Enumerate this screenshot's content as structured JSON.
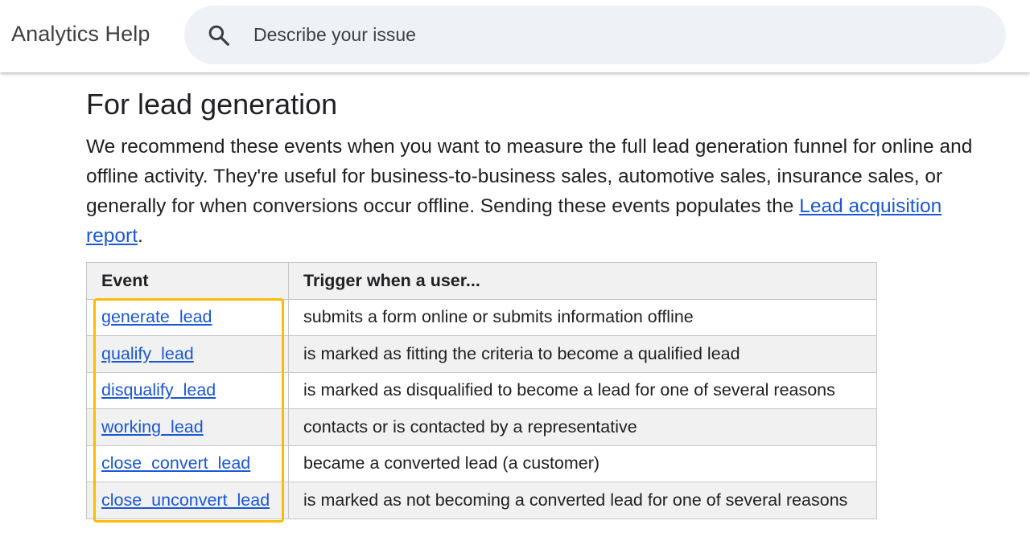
{
  "header": {
    "brand": "Analytics Help",
    "search": {
      "placeholder": "Describe your issue",
      "icon": "search-icon"
    }
  },
  "section": {
    "title": "For lead generation",
    "intro_text": "We recommend these events when you want to measure the full lead generation funnel for online and offline activity. They're useful for business-to-business sales, automotive sales, insurance sales, or generally for when conversions occur offline. Sending these events populates the ",
    "intro_link": "Lead acquisition report",
    "intro_end": "."
  },
  "table": {
    "headers": [
      "Event",
      "Trigger when a user..."
    ],
    "rows": [
      {
        "event": "generate_lead",
        "trigger": "submits a form online or submits information offline"
      },
      {
        "event": "qualify_lead",
        "trigger": "is marked as fitting the criteria to become a qualified lead"
      },
      {
        "event": "disqualify_lead",
        "trigger": "is marked as disqualified to become a lead for one of several reasons"
      },
      {
        "event": "working_lead",
        "trigger": "contacts or is contacted by a representative"
      },
      {
        "event": "close_convert_lead",
        "trigger": "became a converted lead (a customer)"
      },
      {
        "event": "close_unconvert_lead",
        "trigger": "is marked as not becoming a converted lead for one of several reasons"
      }
    ]
  },
  "colors": {
    "link": "#1a57d6",
    "highlight": "#fbbc04",
    "search_bg": "#eef2f6"
  }
}
